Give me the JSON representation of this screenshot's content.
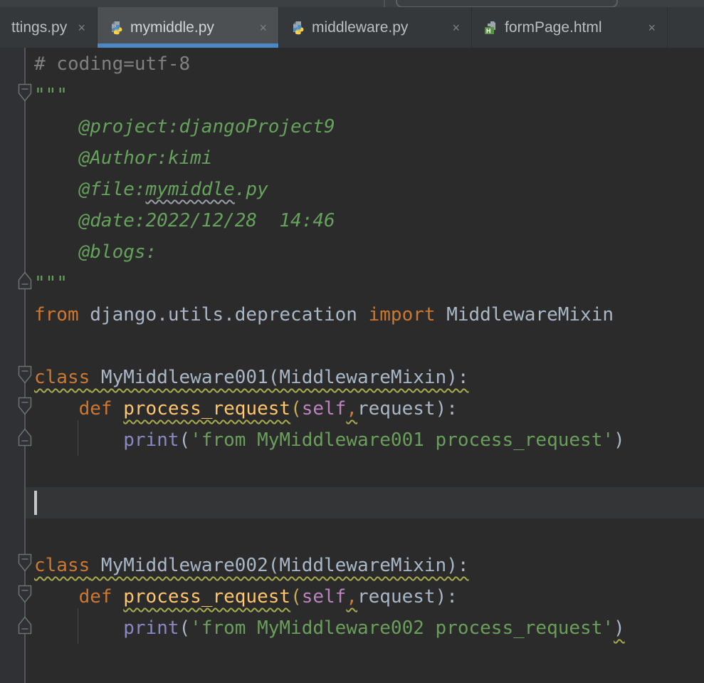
{
  "tab_bar": {
    "close_icon": "×",
    "active_underline_color": "#4A88C7",
    "tabs": [
      {
        "label": "ttings.py",
        "icon": "none",
        "active": false
      },
      {
        "label": "mymiddle.py",
        "icon": "python-file",
        "active": true
      },
      {
        "label": "middleware.py",
        "icon": "python-file",
        "active": false
      },
      {
        "label": "formPage.html",
        "icon": "html-file",
        "active": false
      }
    ]
  },
  "editor": {
    "language": "python",
    "caret": {
      "line": 15,
      "column": 0
    },
    "colors": {
      "background": "#2B2B2B",
      "gutter": "#2F3134",
      "current_line": "#333537",
      "keyword": "#CC7832",
      "docstring": "#65A25C",
      "string": "#6A9F5B",
      "function": "#FFC66D",
      "self": "#BE82BE",
      "builtin": "#8888C6",
      "comment": "#808080",
      "default_text": "#A9B7C6",
      "warning_squiggle": "#A6AC4E",
      "typo_squiggle": "#9AA0A6"
    },
    "fold_markers": [
      {
        "line": 2,
        "type": "start"
      },
      {
        "line": 8,
        "type": "end"
      },
      {
        "line": 11,
        "type": "start"
      },
      {
        "line": 12,
        "type": "start"
      },
      {
        "line": 13,
        "type": "end"
      },
      {
        "line": 17,
        "type": "start"
      },
      {
        "line": 18,
        "type": "start"
      },
      {
        "line": 19,
        "type": "end"
      }
    ],
    "lines": [
      [
        {
          "t": "# coding=utf-8",
          "c": "comment"
        }
      ],
      [
        {
          "t": "\"\"\"",
          "c": "doc"
        }
      ],
      [
        {
          "t": "    @project:djangoProject9",
          "c": "doc"
        }
      ],
      [
        {
          "t": "    @Author:kimi",
          "c": "doc"
        }
      ],
      [
        {
          "t": "    @file:",
          "c": "doc"
        },
        {
          "t": "mymiddle",
          "c": "doc",
          "s": "typo"
        },
        {
          "t": ".py",
          "c": "doc"
        }
      ],
      [
        {
          "t": "    @date:2022/12/28  14:46",
          "c": "doc"
        }
      ],
      [
        {
          "t": "    @blogs:",
          "c": "doc"
        }
      ],
      [
        {
          "t": "\"\"\"",
          "c": "doc"
        }
      ],
      [
        {
          "t": "from",
          "c": "kw"
        },
        {
          "t": " django.utils.deprecation ",
          "c": "plain"
        },
        {
          "t": "import",
          "c": "kw"
        },
        {
          "t": " MiddlewareMixin",
          "c": "plain"
        }
      ],
      [],
      [
        {
          "t": "class",
          "c": "kw",
          "s": "warn"
        },
        {
          "t": " MyMiddleware001(MiddlewareMixin):",
          "c": "plain",
          "s": "warn"
        }
      ],
      [
        {
          "t": "    ",
          "c": "plain"
        },
        {
          "t": "def",
          "c": "kw"
        },
        {
          "t": " ",
          "c": "plain"
        },
        {
          "t": "process_request",
          "c": "func",
          "s": "warn"
        },
        {
          "t": "(",
          "c": "paren"
        },
        {
          "t": "self",
          "c": "self"
        },
        {
          "t": ",",
          "c": "comma",
          "s": "warn"
        },
        {
          "t": "request",
          "c": "plain"
        },
        {
          "t": "):",
          "c": "plain"
        }
      ],
      [
        {
          "t": "        ",
          "c": "plain"
        },
        {
          "t": "print",
          "c": "builtin"
        },
        {
          "t": "(",
          "c": "plain"
        },
        {
          "t": "'from MyMiddleware001 process_request'",
          "c": "string"
        },
        {
          "t": ")",
          "c": "plain"
        }
      ],
      [],
      [],
      [],
      [
        {
          "t": "class",
          "c": "kw",
          "s": "warn"
        },
        {
          "t": " MyMiddleware002(MiddlewareMixin):",
          "c": "plain",
          "s": "warn"
        }
      ],
      [
        {
          "t": "    ",
          "c": "plain"
        },
        {
          "t": "def",
          "c": "kw"
        },
        {
          "t": " ",
          "c": "plain"
        },
        {
          "t": "process_request",
          "c": "func",
          "s": "warn"
        },
        {
          "t": "(",
          "c": "paren"
        },
        {
          "t": "self",
          "c": "self"
        },
        {
          "t": ",",
          "c": "comma",
          "s": "warn"
        },
        {
          "t": "request",
          "c": "plain"
        },
        {
          "t": "):",
          "c": "plain"
        }
      ],
      [
        {
          "t": "        ",
          "c": "plain"
        },
        {
          "t": "print",
          "c": "builtin"
        },
        {
          "t": "(",
          "c": "plain"
        },
        {
          "t": "'from MyMiddleware002 process_request'",
          "c": "string"
        },
        {
          "t": ")",
          "c": "plain",
          "s": "warn"
        }
      ],
      []
    ]
  }
}
